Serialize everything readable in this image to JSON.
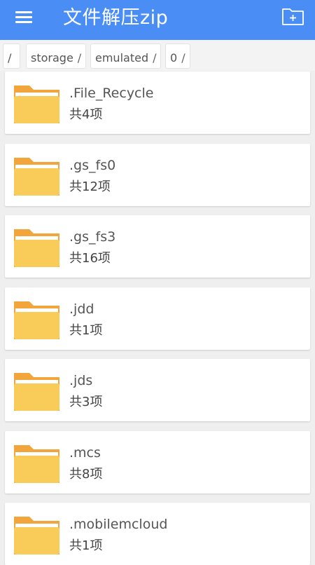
{
  "header": {
    "title": "文件解压zip",
    "menu_icon": "hamburger-menu-icon",
    "new_folder_icon": "new-folder-icon",
    "accent_color": "#4a8ef5"
  },
  "breadcrumb": [
    {
      "label": "/",
      "sep": ""
    },
    {
      "label": "storage",
      "sep": "/"
    },
    {
      "label": "emulated",
      "sep": "/"
    },
    {
      "label": "0",
      "sep": "/"
    }
  ],
  "folders": [
    {
      "name": ".File_Recycle",
      "count": "共4项"
    },
    {
      "name": ".gs_fs0",
      "count": "共12项"
    },
    {
      "name": ".gs_fs3",
      "count": "共16项"
    },
    {
      "name": ".jdd",
      "count": "共1项"
    },
    {
      "name": ".jds",
      "count": "共3项"
    },
    {
      "name": ".mcs",
      "count": "共8项"
    },
    {
      "name": ".mobilemcloud",
      "count": "共1项"
    }
  ],
  "folder_icon": "folder-icon"
}
